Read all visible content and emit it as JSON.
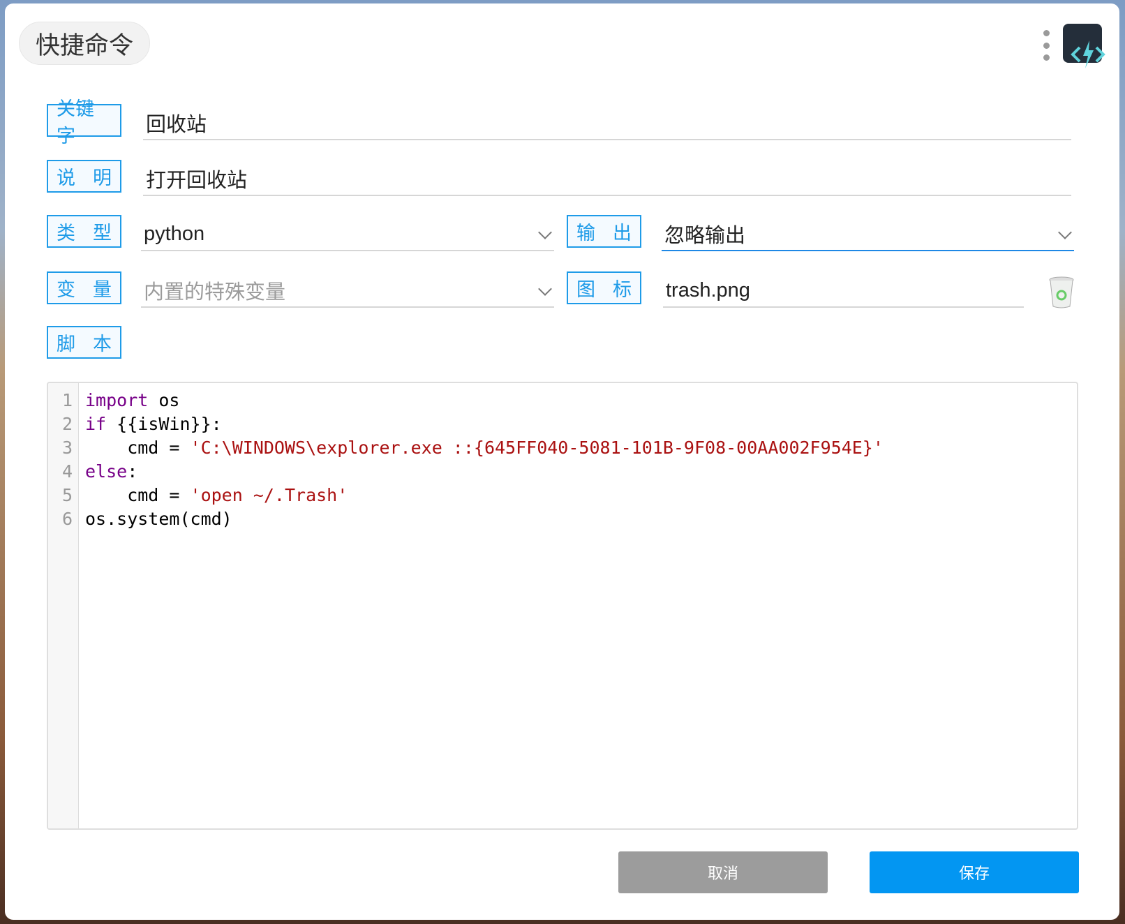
{
  "header": {
    "title": "快捷命令",
    "menu_icon": "more-vertical-icon",
    "logo_icon": "code-bolt-icon"
  },
  "form": {
    "keyword_label": "关键字",
    "keyword_value": "回收站",
    "desc_label": [
      "说",
      "明"
    ],
    "desc_value": "打开回收站",
    "type_label": [
      "类",
      "型"
    ],
    "type_value": "python",
    "output_label": [
      "输",
      "出"
    ],
    "output_value": "忽略输出",
    "vars_label": [
      "变",
      "量"
    ],
    "vars_placeholder": "内置的特殊变量",
    "icon_label": [
      "图",
      "标"
    ],
    "icon_value": "trash.png",
    "script_label": [
      "脚",
      "本"
    ]
  },
  "editor": {
    "line_numbers": [
      "1",
      "2",
      "3",
      "4",
      "5",
      "6"
    ],
    "lines": [
      [
        {
          "t": "import",
          "c": "kw"
        },
        {
          "t": " os",
          "c": ""
        }
      ],
      [
        {
          "t": "if",
          "c": "kw"
        },
        {
          "t": " {{isWin}}:",
          "c": ""
        }
      ],
      [
        {
          "t": "    cmd = ",
          "c": ""
        },
        {
          "t": "'C:\\WINDOWS\\explorer.exe ::{645FF040-5081-101B-9F08-00AA002F954E}'",
          "c": "str"
        }
      ],
      [
        {
          "t": "else",
          "c": "kw"
        },
        {
          "t": ":",
          "c": ""
        }
      ],
      [
        {
          "t": "    cmd = ",
          "c": ""
        },
        {
          "t": "'open ~/.Trash'",
          "c": "str"
        }
      ],
      [
        {
          "t": "os.system(cmd)",
          "c": ""
        }
      ]
    ]
  },
  "buttons": {
    "cancel": "取消",
    "save": "保存"
  },
  "colors": {
    "accent": "#1e9be8",
    "save": "#0396f2",
    "cancel": "#9c9c9c"
  }
}
